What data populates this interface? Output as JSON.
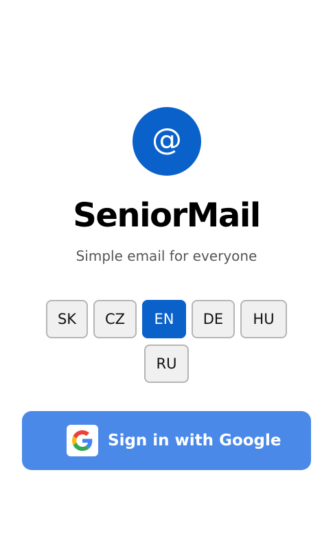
{
  "app": {
    "logo_symbol": "@",
    "title": "SeniorMail",
    "subtitle": "Simple email for everyone"
  },
  "languages": {
    "items": [
      {
        "code": "SK",
        "selected": false
      },
      {
        "code": "CZ",
        "selected": false
      },
      {
        "code": "EN",
        "selected": true
      },
      {
        "code": "DE",
        "selected": false
      },
      {
        "code": "HU",
        "selected": false
      },
      {
        "code": "RU",
        "selected": false
      }
    ]
  },
  "signin": {
    "label": "Sign in with Google",
    "icon": "google-g-icon"
  },
  "colors": {
    "brand": "#0a61c9",
    "google_button": "#4a89e8"
  }
}
